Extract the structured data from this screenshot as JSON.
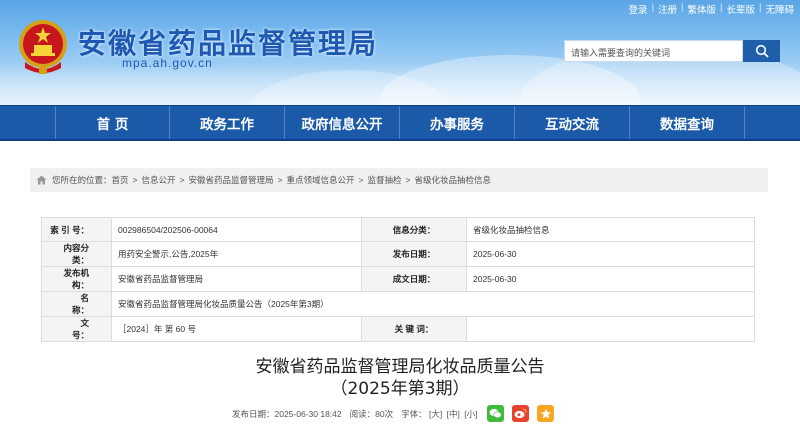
{
  "top_links": [
    "登录",
    "注册",
    "繁体版",
    "长辈版",
    "无障碍"
  ],
  "site": {
    "title": "安徽省药品监督管理局",
    "domain": "mpa.ah.gov.cn"
  },
  "search": {
    "placeholder": "请输入需要查询的关键词"
  },
  "nav": [
    "首 页",
    "政务工作",
    "政府信息公开",
    "办事服务",
    "互动交流",
    "数据查询"
  ],
  "breadcrumb": {
    "prefix": "您所在的位置：",
    "items": [
      "首页",
      "信息公开",
      "安徽省药品监督管理局",
      "重点领域信息公开",
      "监督抽检",
      "省级化妆品抽检信息"
    ]
  },
  "info": {
    "index_label": "索 引 号：",
    "index_value": "002986504/202506-00064",
    "category_label": "信息分类：",
    "category_value": "省级化妆品抽检信息",
    "content_label": "内容分类：",
    "content_value": "用药安全警示,公告,2025年",
    "publish_date_label": "发布日期：",
    "publish_date_value": "2025-06-30",
    "issuer_label": "发布机构：",
    "issuer_value": "安徽省药品监督管理局",
    "created_label": "成文日期：",
    "created_value": "2025-06-30",
    "name_label": "名　　称：",
    "name_value": "安徽省药品监督管理局化妆品质量公告（2025年第3期）",
    "doc_label": "文　　号：",
    "doc_value": "［2024］年 第 60 号",
    "keyword_label": "关 键 词：",
    "keyword_value": ""
  },
  "article": {
    "title_line1": "安徽省药品监督管理局化妆品质量公告",
    "title_line2": "（2025年第3期）",
    "date": "发布日期：2025-06-30 18:42",
    "reads": "阅读：80次",
    "font_label": "字体：",
    "font_large": "[大]",
    "font_medium": "[中]",
    "font_small": "[小]"
  },
  "colors": {
    "nav_bg": "#1a5aa8",
    "title_blue": "#1d58b3",
    "wechat": "#3fba3a",
    "weibo": "#e8432e",
    "favorite": "#f5a623"
  }
}
